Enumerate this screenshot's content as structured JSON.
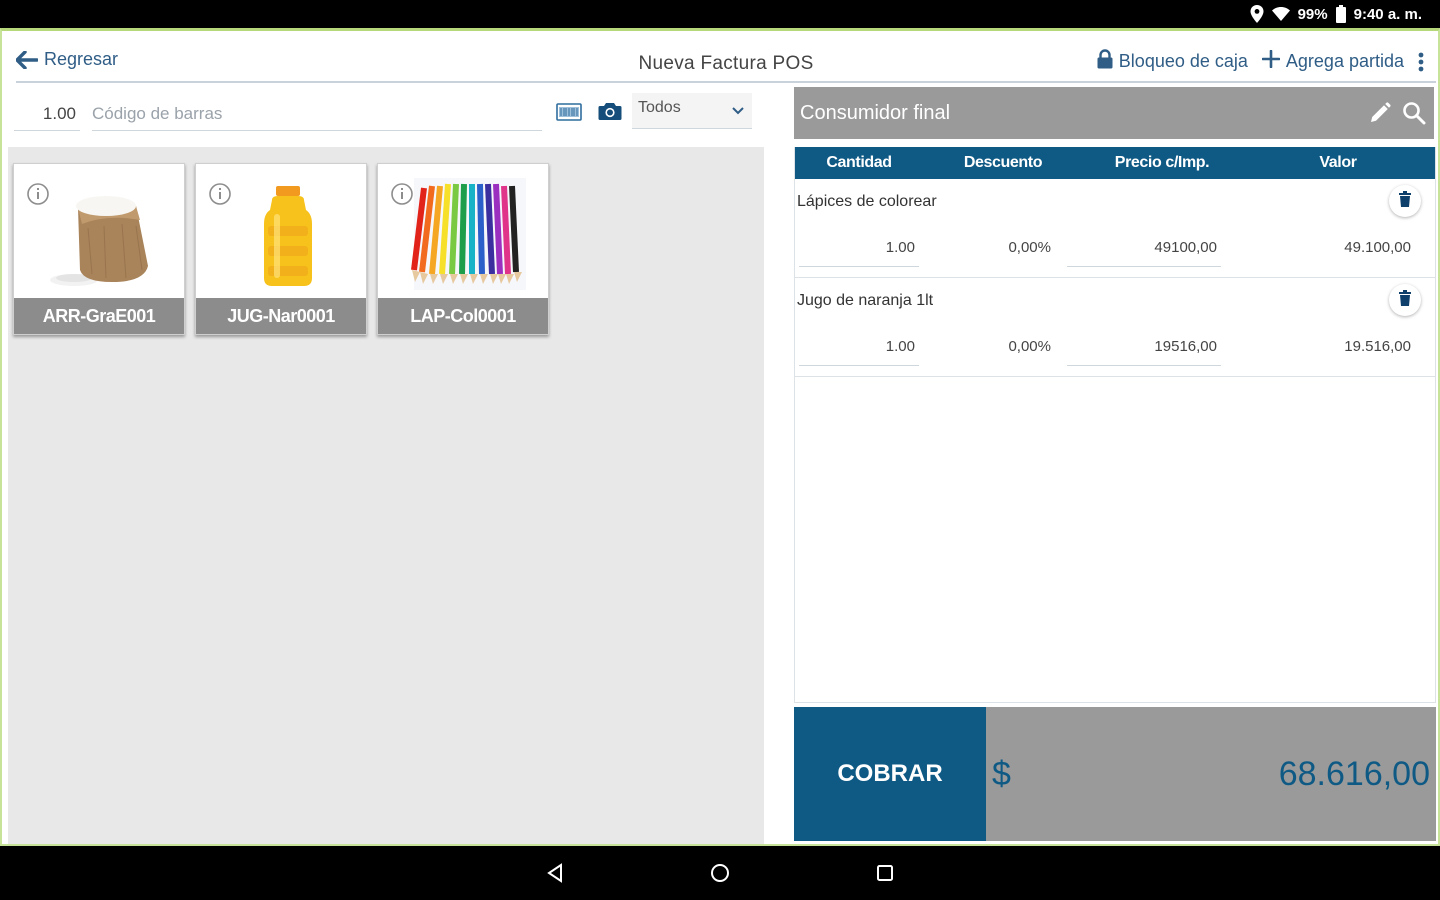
{
  "status_bar": {
    "battery": "99%",
    "time": "9:40 a. m."
  },
  "header": {
    "back_label": "Regresar",
    "title": "Nueva Factura POS",
    "lock_label": "Bloqueo de caja",
    "add_label": "Agrega partida"
  },
  "search": {
    "quantity": "1.00",
    "barcode_placeholder": "Código de barras",
    "category_selected": "Todos"
  },
  "products": [
    {
      "code": "ARR-GraE001"
    },
    {
      "code": "JUG-Nar0001"
    },
    {
      "code": "LAP-Col0001"
    }
  ],
  "customer": {
    "name": "Consumidor final"
  },
  "invoice": {
    "columns": [
      "Cantidad",
      "Descuento",
      "Precio c/Imp.",
      "Valor"
    ],
    "items": [
      {
        "name": "Lápices de colorear",
        "quantity": "1.00",
        "discount": "0,00%",
        "price": "49100,00",
        "value": "49.100,00"
      },
      {
        "name": "Jugo de naranja 1lt",
        "quantity": "1.00",
        "discount": "0,00%",
        "price": "19516,00",
        "value": "19.516,00"
      }
    ]
  },
  "checkout": {
    "charge_label": "COBRAR",
    "currency": "$",
    "total": "68.616,00"
  },
  "colors": {
    "primary": "#0f5a85",
    "link": "#2f5d86",
    "panel_gray": "#9a9a9a",
    "accent_border": "#b6d77a"
  }
}
